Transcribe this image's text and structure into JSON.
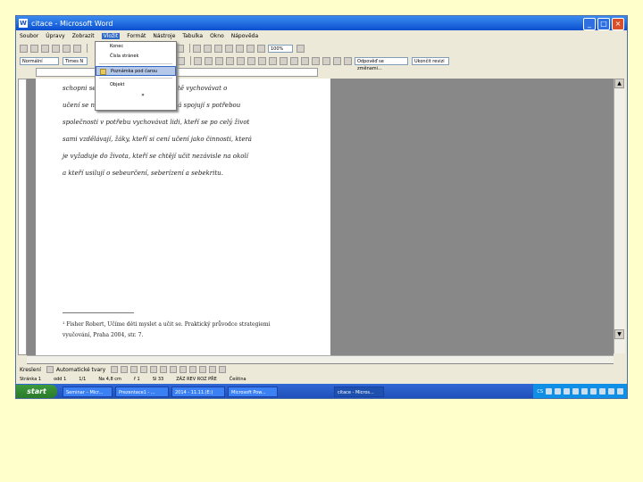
{
  "window": {
    "title": "citace - Microsoft Word",
    "controls": {
      "min": "_",
      "max": "□",
      "close": "×"
    }
  },
  "menubar": {
    "items": [
      "Soubor",
      "Úpravy",
      "Zobrazit",
      "Vložit",
      "Formát",
      "Nástroje",
      "Tabulka",
      "Okno",
      "Nápověda"
    ],
    "active_index": 3
  },
  "toolbar": {
    "zoom": "100%",
    "style": "Normální",
    "font": "Times N",
    "attachment": "Odpověď se změnami...",
    "tracking": "Ukončit revizi"
  },
  "dropdown": {
    "items": [
      "Konec",
      "Čísla stránek",
      "Poznámka pod čarou",
      "Objekt"
    ],
    "highlight_index": 2,
    "more": "»"
  },
  "document": {
    "body_lines": [
      "schopni se učit sami. A tedy na kvalitě vychovávat o",
      "učení se nehraje. Ujasňovací se nemá spojují s potřebou",
      "společnosti v potřebu vychovávat lidi, kteří se po celý život",
      "sami vzdělávají, žáky, kteří si cení učení jako činnosti, která",
      "je vyžaduje do života, kteří se chtějí učit nezávisle na okolí",
      "a kteří usilují o sebeurčení, seberízení a sebekritu."
    ],
    "footnote_lines": [
      "¹ Fisher Robert, Učíme děti myslet a učit se. Praktický průvodce strategiemi",
      "vyučování, Praha 2004, str. 7."
    ]
  },
  "drawbar": {
    "draw_label": "Kreslení",
    "autoshapes_label": "Automatické tvary"
  },
  "statusbar": {
    "page": "Stránka 1",
    "section": "odd 1",
    "pages": "1/1",
    "position": "Na 4,8 cm",
    "row": "ř 1",
    "col": "Sl 33",
    "modes": "ZÁZ REV ROZ PŘE",
    "language": "Čeština"
  },
  "taskbar": {
    "start": "start",
    "tasks": [
      "Seminar – Micr...",
      "Prezentace1 - ...",
      "2014 - 11.11.(E:)",
      "Microsoft Pow...",
      "citace - Micros..."
    ],
    "active_index": 4,
    "clock": "CS"
  }
}
